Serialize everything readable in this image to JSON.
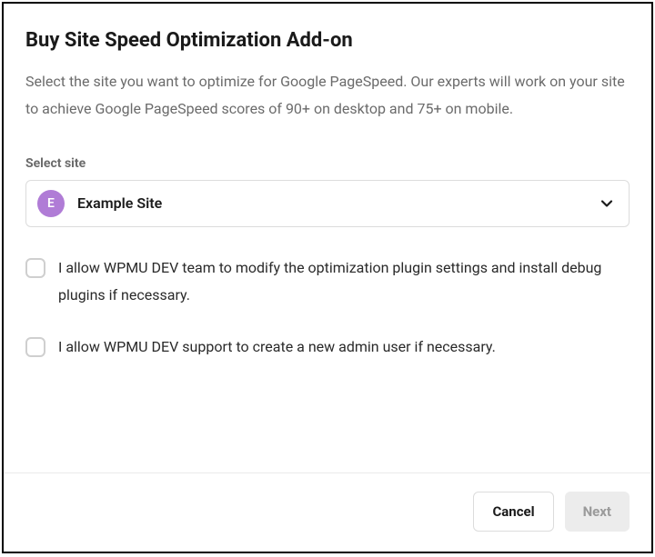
{
  "modal": {
    "title": "Buy Site Speed Optimization Add-on",
    "description": "Select the site you want to optimize for Google PageSpeed. Our experts will work on your site to achieve Google PageSpeed scores of 90+ on desktop and 75+ on mobile."
  },
  "site_select": {
    "label": "Select site",
    "avatar_letter": "E",
    "selected": "Example Site"
  },
  "checks": [
    {
      "label": "I allow WPMU DEV team to modify the optimization plugin settings and install debug plugins if necessary."
    },
    {
      "label": "I allow WPMU DEV support to create a new admin user if necessary."
    }
  ],
  "footer": {
    "cancel": "Cancel",
    "next": "Next"
  },
  "colors": {
    "avatar_bg": "#b07cd6"
  }
}
